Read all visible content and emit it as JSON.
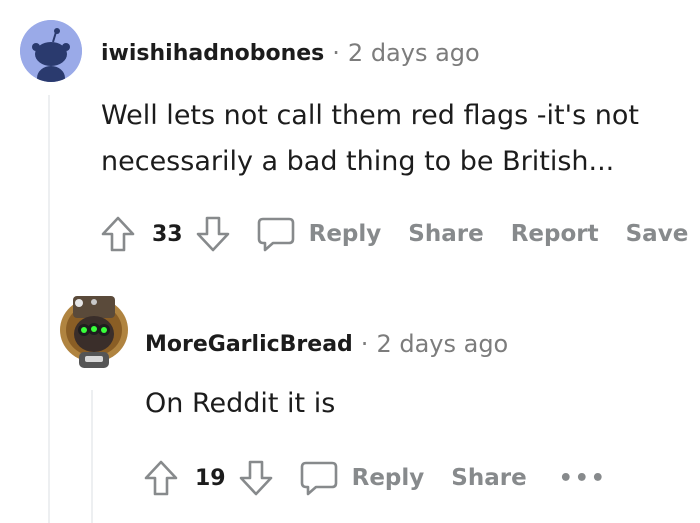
{
  "comments": [
    {
      "username": "iwishihadnobones",
      "separator": "·",
      "time": "2 days ago",
      "body_lines": [
        "Well lets not call them red flags -it's not",
        "necessarily a bad thing to be British..."
      ],
      "votes": "33",
      "actions": {
        "reply": "Reply",
        "share": "Share",
        "report": "Report",
        "save": "Save"
      }
    },
    {
      "username": "MoreGarlicBread",
      "separator": "·",
      "time": "2 days ago",
      "body_lines": [
        "On Reddit it is"
      ],
      "votes": "19",
      "actions": {
        "reply": "Reply",
        "share": "Share",
        "more": "•••"
      }
    }
  ],
  "colors": {
    "text": "#1c1c1c",
    "muted": "#878a8c",
    "meta": "#7c7c7c",
    "thread_line": "#edeff1",
    "avatar1_bg": "#9aaae8"
  }
}
